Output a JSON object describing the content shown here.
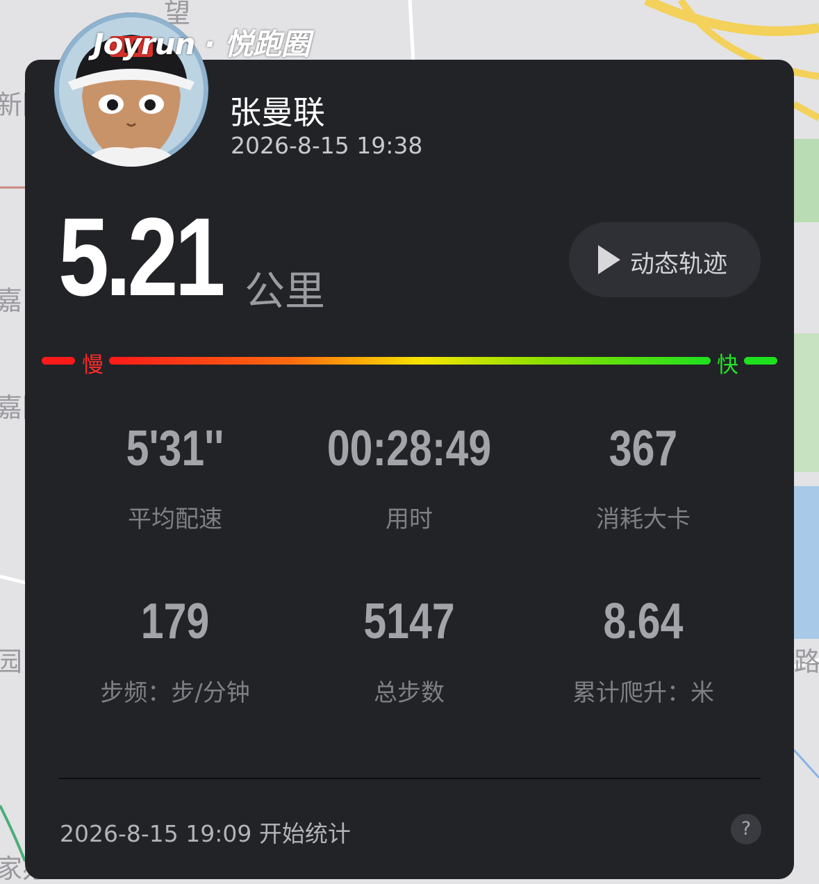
{
  "brand": {
    "name": "Joyrun · 悦跑圈"
  },
  "map": {
    "labels": [
      "望",
      "新园",
      "嘉",
      "嘉园",
      "园",
      "路",
      "家办"
    ]
  },
  "user": {
    "name": "张曼联",
    "post_time": "2026-8-15 19:38"
  },
  "run": {
    "distance": "5.21",
    "distance_unit": "公里"
  },
  "replay_button": {
    "label": "动态轨迹"
  },
  "pace_legend": {
    "slow": "慢",
    "fast": "快"
  },
  "stats": [
    {
      "value": "5'31''",
      "label": "平均配速"
    },
    {
      "value": "00:28:49",
      "label": "用时"
    },
    {
      "value": "367",
      "label": "消耗大卡"
    },
    {
      "value": "179",
      "label": "步频：步/分钟"
    },
    {
      "value": "5147",
      "label": "总步数"
    },
    {
      "value": "8.64",
      "label": "累计爬升：米"
    }
  ],
  "footer": {
    "start_info": "2026-8-15 19:09 开始统计",
    "help_label": "?"
  },
  "colors": {
    "card_bg": "#222327",
    "pace_slow": "#ff1a1a",
    "pace_mid": "#f5e400",
    "pace_fast": "#1fe01f"
  }
}
